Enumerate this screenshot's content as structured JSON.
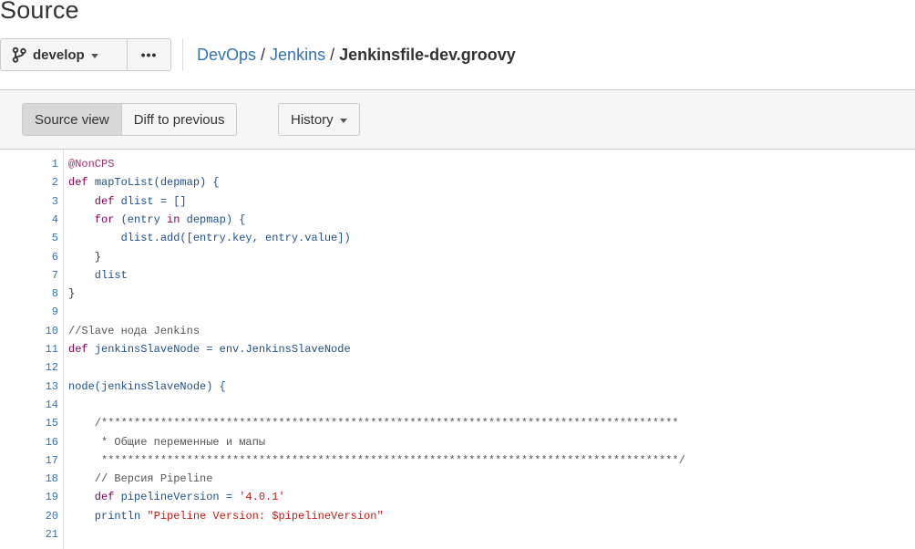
{
  "page": {
    "title": "Source"
  },
  "toolbar": {
    "branch_label": "develop",
    "branch_icon": "branch-icon",
    "more_label": "•••"
  },
  "breadcrumb": {
    "parts": [
      "DevOps",
      "Jenkins"
    ],
    "separator": "/",
    "current": "Jenkinsfile-dev.groovy"
  },
  "file_toolbar": {
    "source_view_label": "Source view",
    "diff_label": "Diff to previous",
    "history_label": "History"
  },
  "colors": {
    "link": "#3572b0",
    "keyword": "#7f0055",
    "identifier": "#1f4f8a",
    "annotation": "#a0306e",
    "string": "#c41a16",
    "comment": "#555555"
  },
  "code": {
    "lines": [
      {
        "num": "1",
        "tokens": [
          {
            "t": "@NonCPS",
            "c": "ann"
          }
        ]
      },
      {
        "num": "2",
        "tokens": [
          {
            "t": "def ",
            "c": "kw"
          },
          {
            "t": "mapToList(depmap) {",
            "c": "id"
          }
        ]
      },
      {
        "num": "3",
        "tokens": [
          {
            "t": "    def ",
            "c": "kw"
          },
          {
            "t": "dlist = []",
            "c": "id"
          }
        ]
      },
      {
        "num": "4",
        "tokens": [
          {
            "t": "    for ",
            "c": "kw"
          },
          {
            "t": "(entry ",
            "c": "id"
          },
          {
            "t": "in ",
            "c": "kw"
          },
          {
            "t": "depmap) {",
            "c": "id"
          }
        ]
      },
      {
        "num": "5",
        "tokens": [
          {
            "t": "        dlist.add([entry.key, entry.value])",
            "c": "id"
          }
        ]
      },
      {
        "num": "6",
        "tokens": [
          {
            "t": "    }",
            "c": "txt"
          }
        ]
      },
      {
        "num": "7",
        "tokens": [
          {
            "t": "    dlist",
            "c": "id"
          }
        ]
      },
      {
        "num": "8",
        "tokens": [
          {
            "t": "}",
            "c": "txt"
          }
        ]
      },
      {
        "num": "9",
        "tokens": []
      },
      {
        "num": "10",
        "tokens": [
          {
            "t": "//Slave нода Jenkins",
            "c": "cmt"
          }
        ]
      },
      {
        "num": "11",
        "tokens": [
          {
            "t": "def ",
            "c": "kw"
          },
          {
            "t": "jenkinsSlaveNode = env.JenkinsSlaveNode",
            "c": "id"
          }
        ]
      },
      {
        "num": "12",
        "tokens": []
      },
      {
        "num": "13",
        "tokens": [
          {
            "t": "node(jenkinsSlaveNode) {",
            "c": "id"
          }
        ]
      },
      {
        "num": "14",
        "tokens": []
      },
      {
        "num": "15",
        "tokens": [
          {
            "t": "    /****************************************************************************************",
            "c": "cmt"
          }
        ]
      },
      {
        "num": "16",
        "tokens": [
          {
            "t": "     * Общие переменные и мапы",
            "c": "cmt"
          }
        ]
      },
      {
        "num": "17",
        "tokens": [
          {
            "t": "     ****************************************************************************************/",
            "c": "cmt"
          }
        ]
      },
      {
        "num": "18",
        "tokens": [
          {
            "t": "    // Версия Pipeline",
            "c": "cmt"
          }
        ]
      },
      {
        "num": "19",
        "tokens": [
          {
            "t": "    def ",
            "c": "kw"
          },
          {
            "t": "pipelineVersion = ",
            "c": "id"
          },
          {
            "t": "'4.0.1'",
            "c": "str"
          }
        ]
      },
      {
        "num": "20",
        "tokens": [
          {
            "t": "    println ",
            "c": "id"
          },
          {
            "t": "\"Pipeline Version: $pipelineVersion\"",
            "c": "str"
          }
        ]
      },
      {
        "num": "21",
        "tokens": []
      }
    ]
  }
}
